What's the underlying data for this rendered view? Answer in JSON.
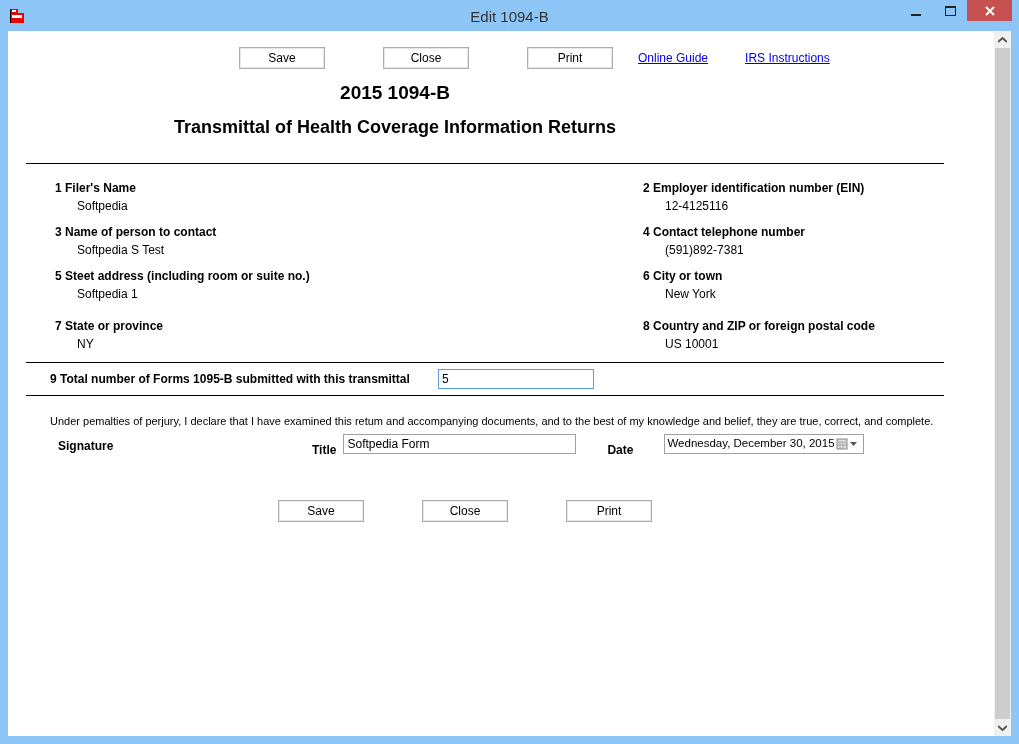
{
  "window": {
    "title": "Edit 1094-B"
  },
  "top_buttons": [
    "Save",
    "Close",
    "Print"
  ],
  "links": [
    "Online Guide",
    "IRS Instructions"
  ],
  "heading": "2015 1094-B",
  "subheading": "Transmittal of Health Coverage Information Returns",
  "fields": [
    {
      "label": "1 Filer's Name",
      "value": "Softpedia"
    },
    {
      "label": "2 Employer identification number (EIN)",
      "value": "12-4125116"
    },
    {
      "label": "3 Name of person to contact",
      "value": "Softpedia S Test"
    },
    {
      "label": "4 Contact telephone number",
      "value": "(591)892-7381"
    },
    {
      "label": "5 Steet address (including room or suite no.)",
      "value": "Softpedia 1"
    },
    {
      "label": "6 City or town",
      "value": "New York"
    },
    {
      "label": "7 State or province",
      "value": "NY"
    },
    {
      "label": "8 Country and ZIP or foreign postal code",
      "value": "US 10001"
    }
  ],
  "total": {
    "label": "9 Total number of Forms 1095-B submitted with this transmittal",
    "value": "5"
  },
  "declaration": "Under pemalties of perjury, I declare that I have examined this retum and accompanying documents, and to the best of my knowledge and belief, they are true, correct, and complete.",
  "signature_label": "Signature",
  "title_field": {
    "label": "Title",
    "value": "Softpedia Form"
  },
  "date_field": {
    "label": "Date",
    "value": "Wednesday, December 30, 2015"
  },
  "bottom_buttons": [
    "Save",
    "Close",
    "Print"
  ]
}
